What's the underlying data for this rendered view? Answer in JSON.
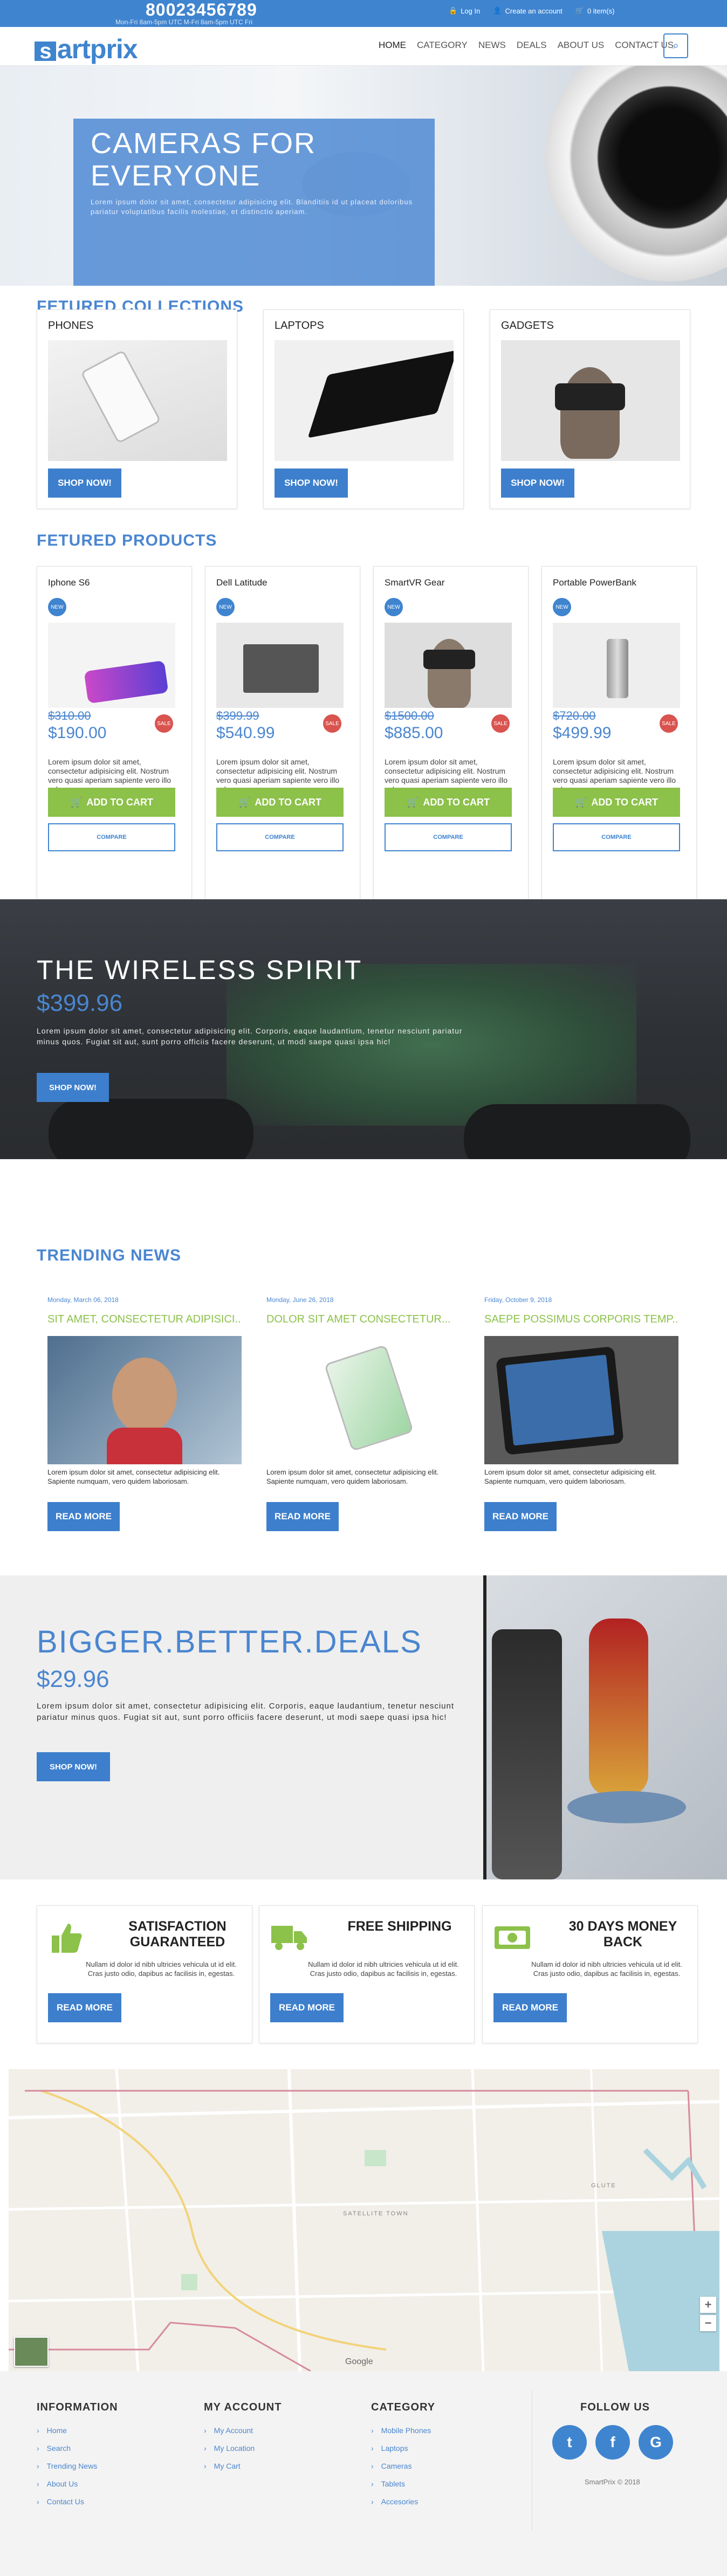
{
  "topbar": {
    "phone": "80023456789",
    "hours": "Mon-Fri 8am-5pm UTC M-Fri 8am-5pm UTC Fri",
    "login": "Log In",
    "create_account": "Create an account",
    "cart": "0 item(s)"
  },
  "header": {
    "logo_prefix": "s",
    "logo_text": "artprix",
    "nav": [
      "HOME",
      "CATEGORY",
      "NEWS",
      "DEALS",
      "ABOUT US",
      "CONTACT US"
    ]
  },
  "hero": {
    "title": "CAMERAS FOR EVERYONE",
    "text": "Lorem ipsum dolor sit amet, consectetur adipisicing elit. Blanditiis id ut placeat doloribus pariatur voluptatibus facilis molestiae, et distinctio aperiam."
  },
  "collections": {
    "title": "FETURED COLLECTIONS",
    "button": "SHOP NOW!",
    "items": [
      {
        "name": "PHONES"
      },
      {
        "name": "LAPTOPS"
      },
      {
        "name": "GADGETS"
      }
    ]
  },
  "products": {
    "title": "FETURED PRODUCTS",
    "new_badge": "NEW",
    "sale_badge": "SALE",
    "cart_label": "ADD TO CART",
    "compare_label": "COMPARE",
    "desc": "Lorem ipsum dolor sit amet, consectetur adipisicing elit. Nostrum vero quasi aperiam sapiente vero illo culpa.",
    "items": [
      {
        "name": "Iphone S6",
        "old_price": "$310.00",
        "price": "$190.00"
      },
      {
        "name": "Dell Latitude",
        "old_price": "$399.99",
        "price": "$540.99"
      },
      {
        "name": "SmartVR Gear",
        "old_price": "$1500.00",
        "price": "$885.00"
      },
      {
        "name": "Portable PowerBank",
        "old_price": "$720.00",
        "price": "$499.99"
      }
    ]
  },
  "wireless": {
    "title": "THE WIRELESS SPIRIT",
    "price": "$399.96",
    "text": "Lorem ipsum dolor sit amet, consectetur adipisicing elit. Corporis, eaque laudantium, tenetur nesciunt pariatur minus quos. Fugiat sit aut, sunt porro officiis facere deserunt, ut modi saepe quasi ipsa hic!",
    "button": "SHOP NOW!"
  },
  "news": {
    "title": "TRENDING NEWS",
    "button": "READ MORE",
    "text": "Lorem ipsum dolor sit amet, consectetur adipisicing elit. Sapiente numquam, vero quidem laboriosam.",
    "items": [
      {
        "date": "Monday, March 06, 2018",
        "title": "SIT AMET, CONSECTETUR ADIPISICI..."
      },
      {
        "date": "Monday, June 26, 2018",
        "title": "DOLOR SIT AMET CONSECTETUR..."
      },
      {
        "date": "Friday, October 9, 2018",
        "title": "SAEPE POSSIMUS CORPORIS TEMP..."
      }
    ]
  },
  "deals": {
    "title": "BIGGER.BETTER.DEALS",
    "price": "$29.96",
    "text": "Lorem ipsum dolor sit amet, consectetur adipisicing elit. Corporis, eaque laudantium, tenetur nesciunt pariatur minus quos. Fugiat sit aut, sunt porro officiis facere deserunt, ut modi saepe quasi ipsa hic!",
    "button": "SHOP NOW!"
  },
  "features": {
    "button": "READ MORE",
    "text": "Nullam id dolor id nibh ultricies vehicula ut id elit. Cras justo odio, dapibus ac facilisis in, egestas.",
    "items": [
      {
        "title": "SATISFACTION GUARANTEED",
        "icon": "thumbs-up-icon"
      },
      {
        "title": "FREE SHIPPING",
        "icon": "truck-icon"
      },
      {
        "title": "30 DAYS MONEY BACK",
        "icon": "money-icon"
      }
    ]
  },
  "map": {
    "label": "SATELLITE TOWN",
    "label2": "GLUTE",
    "provider": "Google"
  },
  "footer": {
    "information": {
      "title": "INFORMATION",
      "links": [
        "Home",
        "Search",
        "Trending News",
        "About Us",
        "Contact Us"
      ]
    },
    "account": {
      "title": "MY ACCOUNT",
      "links": [
        "My Account",
        "My Location",
        "My Cart"
      ]
    },
    "category": {
      "title": "CATEGORY",
      "links": [
        "Mobile Phones",
        "Laptops",
        "Cameras",
        "Tablets",
        "Accesories"
      ]
    },
    "follow": {
      "title": "FOLLOW US",
      "copyright": "SmartPrix © 2018"
    }
  },
  "colors": {
    "primary": "#3f84cf",
    "green": "#8cc14a",
    "sale": "#d9534f"
  }
}
